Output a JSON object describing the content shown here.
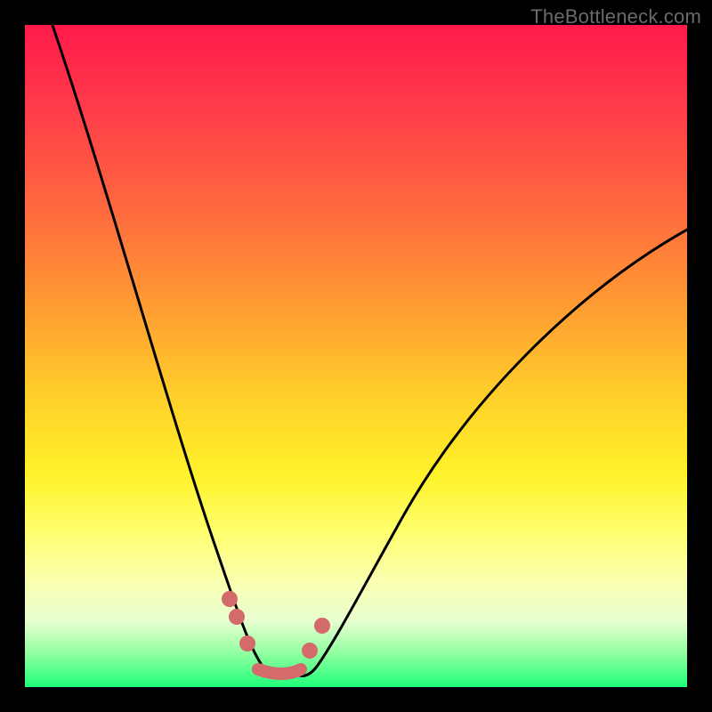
{
  "watermark": "TheBottleneck.com",
  "colors": {
    "frame": "#000000",
    "curve": "#000000",
    "marker": "#d46a6a"
  },
  "chart_data": {
    "type": "line",
    "title": "",
    "xlabel": "",
    "ylabel": "",
    "x": [
      0.0,
      0.05,
      0.1,
      0.15,
      0.2,
      0.25,
      0.3,
      0.33,
      0.36,
      0.39,
      0.43,
      0.5,
      0.6,
      0.7,
      0.8,
      0.9,
      1.0
    ],
    "values": [
      100,
      86,
      72,
      58,
      44,
      30,
      16,
      6,
      0,
      0,
      6,
      16,
      32,
      44,
      54,
      62,
      68
    ],
    "xlim": [
      0,
      1
    ],
    "ylim": [
      0,
      100
    ],
    "markers": {
      "left_rise": [
        {
          "x": 0.305,
          "y": 14
        },
        {
          "x": 0.315,
          "y": 11
        },
        {
          "x": 0.33,
          "y": 7
        }
      ],
      "right_rise": [
        {
          "x": 0.42,
          "y": 6
        },
        {
          "x": 0.44,
          "y": 10
        }
      ],
      "flat_segment": {
        "x0": 0.345,
        "x1": 0.405,
        "y": 2
      }
    }
  }
}
